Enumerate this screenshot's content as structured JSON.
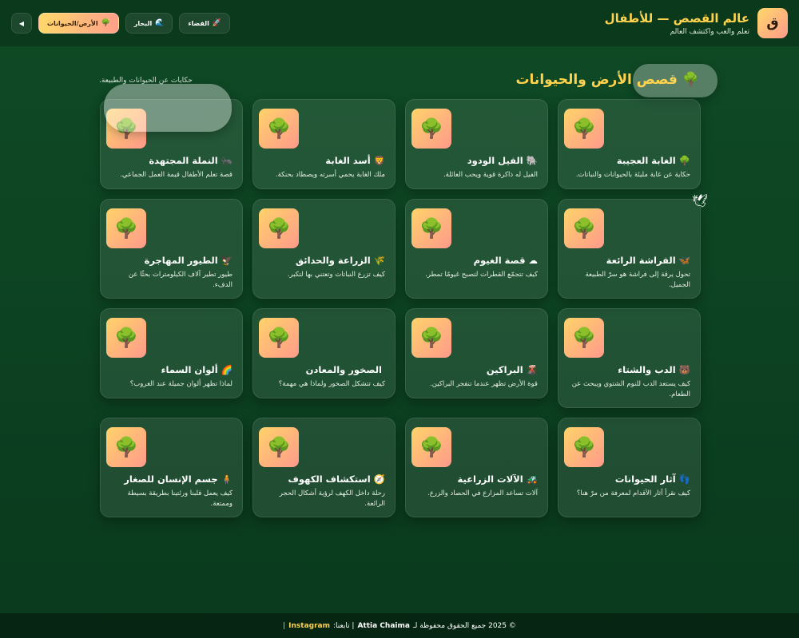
{
  "header": {
    "logo_letter": "ق",
    "title": "عالم القصص — للأطفال",
    "subtitle": "تعلم والعب واكتشف العالم",
    "nav": [
      {
        "id": "earth",
        "label": "الأرض/الحيوانات",
        "icon": "🌳",
        "active": true
      },
      {
        "id": "sea",
        "label": "البحار",
        "icon": "🌊"
      },
      {
        "id": "space",
        "label": "الفضاء",
        "icon": "🚀"
      }
    ],
    "arrow_glyph": "◀"
  },
  "section": {
    "icon": "🌳",
    "title": "قصص الأرض والحيوانات",
    "subtitle": "حكايات عن الحيوانات والطبيعة."
  },
  "cards": [
    {
      "emoji": "🌳",
      "title": "الغابة العجيبة",
      "title_icon": "🌳",
      "desc": "حكاية عن غابة مليئة بالحيوانات والنباتات."
    },
    {
      "emoji": "🌳",
      "title": "الفيل الودود",
      "title_icon": "🐘",
      "desc": "الفيل له ذاكرة قوية ويحب العائلة."
    },
    {
      "emoji": "🌳",
      "title": "أسد الغابة",
      "title_icon": "🦁",
      "desc": "ملك الغابة يحمي أسرته ويصطاد بحنكة."
    },
    {
      "emoji": "🌳",
      "title": "النملة المجتهدة",
      "title_icon": "🐜",
      "desc": "قصة تعلم الأطفال قيمة العمل الجماعي."
    },
    {
      "emoji": "🌳",
      "title": "الفراشة الرائعة",
      "title_icon": "🦋",
      "desc": "تحول يرقة إلى فراشة هو سرّ الطبيعة الجميل."
    },
    {
      "emoji": "🌳",
      "title": "قصة الغيوم",
      "title_icon": "☁",
      "desc": "كيف تتجمّع القطرات لتصبح غيومًا تمطر."
    },
    {
      "emoji": "🌳",
      "title": "الزراعة والحدائق",
      "title_icon": "🌾",
      "desc": "كيف تزرع النباتات وتعتني بها لتكبر."
    },
    {
      "emoji": "🌳",
      "title": "الطيور المهاجرة",
      "title_icon": "🦅",
      "desc": "طيور تطير آلاف الكيلومترات بحثًا عن الدفء."
    },
    {
      "emoji": "🌳",
      "title": "الدب والشتاء",
      "title_icon": "🐻",
      "desc": "كيف يستعد الدب للنوم الشتوي ويبحث عن الطعام."
    },
    {
      "emoji": "🌳",
      "title": "البراكين",
      "title_icon": "🌋",
      "desc": "قوة الأرض تظهر عندما تنفجر البراكين."
    },
    {
      "emoji": "🌳",
      "title": "الصخور والمعادن",
      "title_icon": "",
      "desc": "كيف تتشكل الصخور ولماذا هي مهمة؟"
    },
    {
      "emoji": "🌳",
      "title": "ألوان السماء",
      "title_icon": "🌈",
      "desc": "لماذا تظهر ألوان جميلة عند الغروب؟"
    },
    {
      "emoji": "🌳",
      "title": "آثار الحيوانات",
      "title_icon": "👣",
      "desc": "كيف نقرأ آثار الأقدام لمعرفة من مرّ هنا؟"
    },
    {
      "emoji": "🌳",
      "title": "الآلات الزراعية",
      "title_icon": "🚜",
      "desc": "آلات تساعد المزارع في الحصاد والزرع."
    },
    {
      "emoji": "🌳",
      "title": "استكشاف الكهوف",
      "title_icon": "🧭",
      "desc": "رحلة داخل الكهف لرؤية أشكال الحجر الرائعة."
    },
    {
      "emoji": "🌳",
      "title": "جسم الإنسان للصغار",
      "title_icon": "🧍",
      "desc": "كيف يعمل قلبنا ورئتينا بطريقة بسيطة وممتعة."
    }
  ],
  "decor": {
    "dove": "🕊"
  },
  "footer": {
    "copyright": "© 2025 جميع الحقوق محفوظة لـ",
    "author": "Attia Chaima",
    "follow": "| تابعنا:",
    "instagram": "Instagram",
    "end_sep": "|"
  },
  "colors": {
    "accent": "#ffd34d",
    "thumb_from": "#ffd36a",
    "thumb_to": "#ff9a8b",
    "bg": "#0d4422"
  }
}
